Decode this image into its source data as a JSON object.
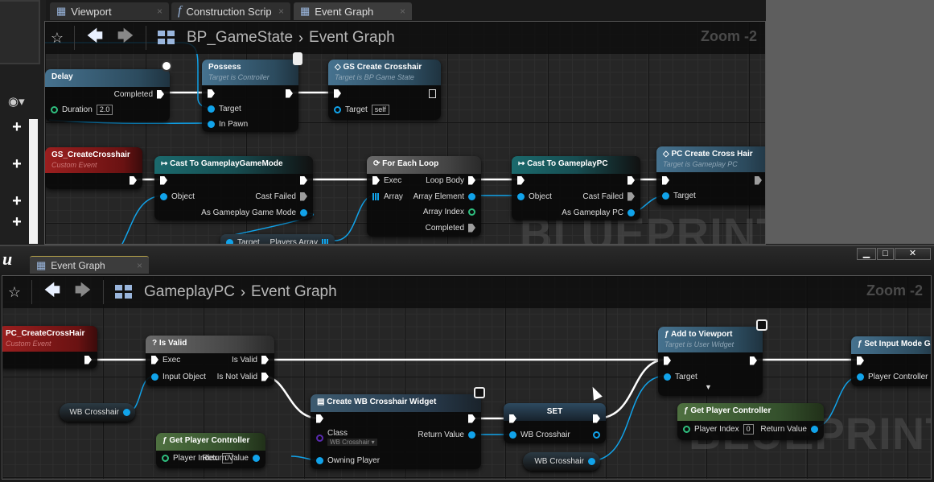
{
  "top_window": {
    "tabs": [
      {
        "label": "Viewport"
      },
      {
        "label": "Construction Scrip"
      },
      {
        "label": "Event Graph"
      }
    ],
    "breadcrumb": {
      "blueprint": "BP_GameState",
      "graph": "Event Graph"
    },
    "zoom": "Zoom -2",
    "watermark": "BLUEPRINT",
    "nodes": {
      "delay": {
        "title": "Delay",
        "completed": "Completed",
        "duration_label": "Duration",
        "duration_value": "2.0"
      },
      "possess": {
        "title": "Possess",
        "subtitle": "Target is Controller",
        "target": "Target",
        "in_pawn": "In Pawn"
      },
      "gs_create": {
        "title": "GS Create Crosshair",
        "subtitle": "Target is BP Game State",
        "target": "Target",
        "target_value": "self"
      },
      "gs_event": {
        "title": "GS_CreateCrosshair",
        "subtitle": "Custom Event"
      },
      "cast_gm": {
        "title": "Cast To GameplayGameMode",
        "object": "Object",
        "cast_failed": "Cast Failed",
        "as": "As Gameplay Game Mode"
      },
      "foreach": {
        "title": "For Each Loop",
        "exec": "Exec",
        "array": "Array",
        "loop_body": "Loop Body",
        "array_element": "Array Element",
        "array_index": "Array Index",
        "completed": "Completed"
      },
      "cast_pc": {
        "title": "Cast To GameplayPC",
        "object": "Object",
        "cast_failed": "Cast Failed",
        "as": "As Gameplay PC"
      },
      "pc_create": {
        "title": "PC Create Cross Hair",
        "subtitle": "Target is Gameplay PC",
        "target": "Target"
      },
      "players_array": {
        "target": "Target",
        "output": "Players Array"
      }
    }
  },
  "bottom_window": {
    "tab": "Event Graph",
    "breadcrumb": {
      "blueprint": "GameplayPC",
      "graph": "Event Graph"
    },
    "zoom": "Zoom -2",
    "watermark": "BLUEPRINT",
    "window_buttons": {
      "minimize": "▁",
      "maximize": "□",
      "close": "✕"
    },
    "nodes": {
      "pc_event": {
        "title": "PC_CreateCrossHair",
        "subtitle": "Custom Event"
      },
      "is_valid": {
        "title": "Is Valid",
        "exec": "Exec",
        "input_object": "Input Object",
        "is_valid": "Is Valid",
        "is_not_valid": "Is Not Valid"
      },
      "wb_get1": {
        "label": "WB Crosshair"
      },
      "get_pc1": {
        "title": "Get Player Controller",
        "player_index": "Player Index",
        "player_index_value": "0",
        "return_value": "Return Value"
      },
      "create_widget": {
        "title": "Create WB Crosshair Widget",
        "class": "Class",
        "class_value": "WB Crosshair",
        "return_value": "Return Value",
        "owning_player": "Owning Player"
      },
      "set": {
        "title": "SET",
        "wb": "WB Crosshair"
      },
      "wb_get2": {
        "label": "WB Crosshair"
      },
      "add_viewport": {
        "title": "Add to Viewport",
        "subtitle": "Target is User Widget",
        "target": "Target"
      },
      "get_pc2": {
        "title": "Get Player Controller",
        "player_index": "Player Index",
        "player_index_value": "0",
        "return_value": "Return Value"
      },
      "set_input": {
        "title": "Set Input Mode Ga",
        "player_controller": "Player Controller"
      }
    }
  },
  "colors": {
    "exec_wire": "#ffffff",
    "object_wire": "#11a3ea",
    "function_header": "#46728f",
    "event_header": "#9b1f1f",
    "cast_header": "#1b6a6d",
    "pure_header": "#4e7040"
  }
}
